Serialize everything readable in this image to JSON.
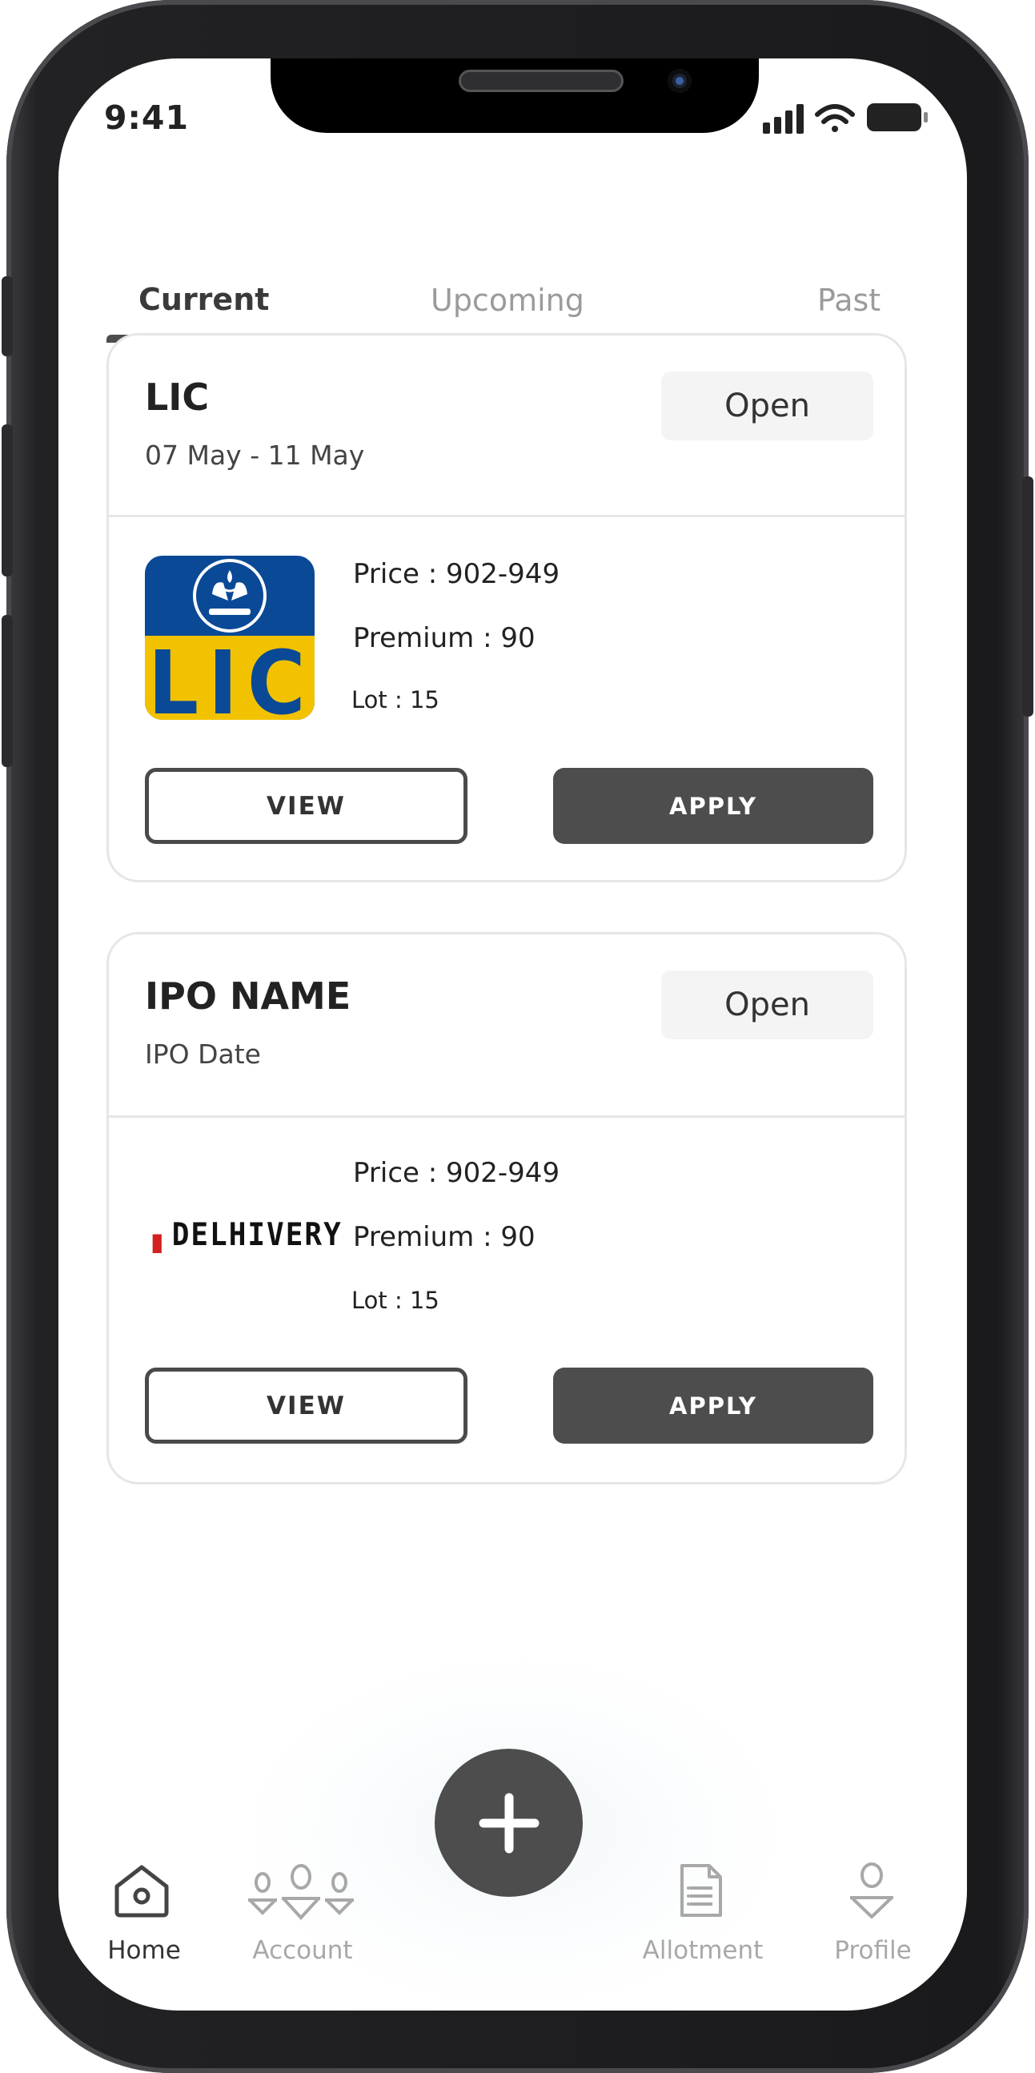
{
  "status_bar": {
    "time": "9:41"
  },
  "tabs": [
    {
      "label": "Current",
      "active": true
    },
    {
      "label": "Upcoming",
      "active": false
    },
    {
      "label": "Past",
      "active": false
    }
  ],
  "ipos": [
    {
      "name": "LIC",
      "date": "07 May - 11 May",
      "status": "Open",
      "logo": "lic-logo",
      "logo_text": "LIC",
      "price": "Price : 902-949",
      "premium": "Premium : 90",
      "lot": "Lot : 15",
      "view_label": "VIEW",
      "apply_label": "APPLY"
    },
    {
      "name": "IPO NAME",
      "date": "IPO Date",
      "status": "Open",
      "logo": "delhivery-logo",
      "logo_text": "DELHIVERY",
      "price": "Price : 902-949",
      "premium": "Premium : 90",
      "lot": "Lot : 15",
      "view_label": "VIEW",
      "apply_label": "APPLY"
    }
  ],
  "bottom_nav": {
    "items": [
      {
        "label": "Home",
        "icon": "home-icon",
        "active": true
      },
      {
        "label": "Account",
        "icon": "users-icon",
        "active": false
      },
      {
        "label": "Allotment",
        "icon": "document-icon",
        "active": false
      },
      {
        "label": "Profile",
        "icon": "user-icon",
        "active": false
      }
    ],
    "fab_icon": "plus-icon"
  },
  "colors": {
    "primary_dark": "#4d4d4d",
    "inactive": "#a8a8a8",
    "lic_blue": "#0a4996",
    "lic_yellow": "#f2c200",
    "delhivery_red": "#d32020"
  }
}
